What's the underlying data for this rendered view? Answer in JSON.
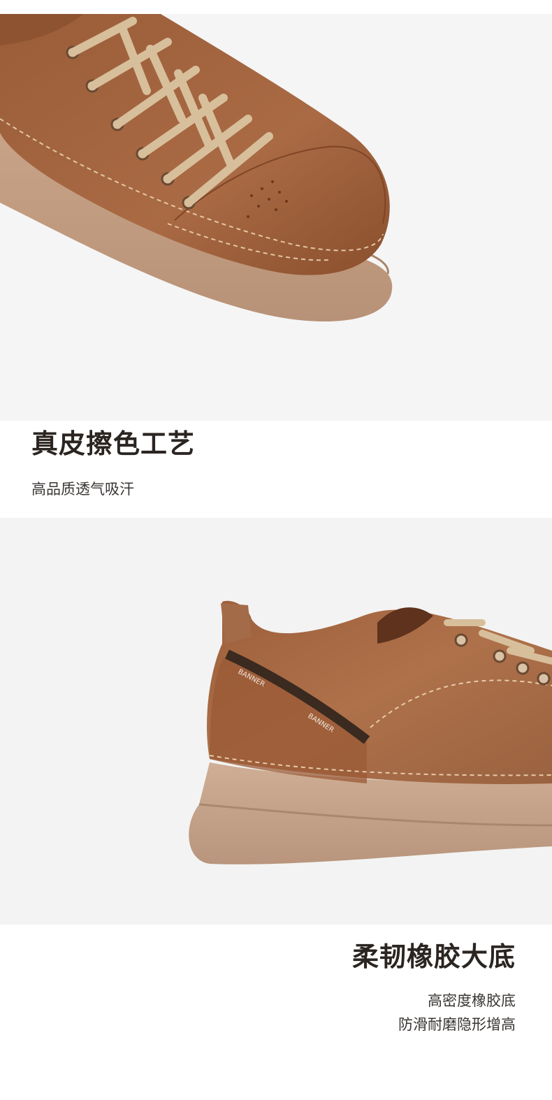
{
  "section1": {
    "title": "真皮擦色工艺",
    "subtitle": "高品质透气吸汗",
    "image": {
      "description_icon": "shoe-toe-closeup-image",
      "leather_color": "#a8663f",
      "sole_color": "#c9a58a",
      "lace_color": "#d8bf9c"
    }
  },
  "section2": {
    "title": "柔韧橡胶大底",
    "sublines": [
      "高密度橡胶底",
      "防滑耐磨隐形增高"
    ],
    "image": {
      "description_icon": "shoe-heel-sole-image",
      "leather_color": "#a86a45",
      "sole_color": "#c6a58c",
      "brand_tab_text": "BANNER"
    }
  }
}
